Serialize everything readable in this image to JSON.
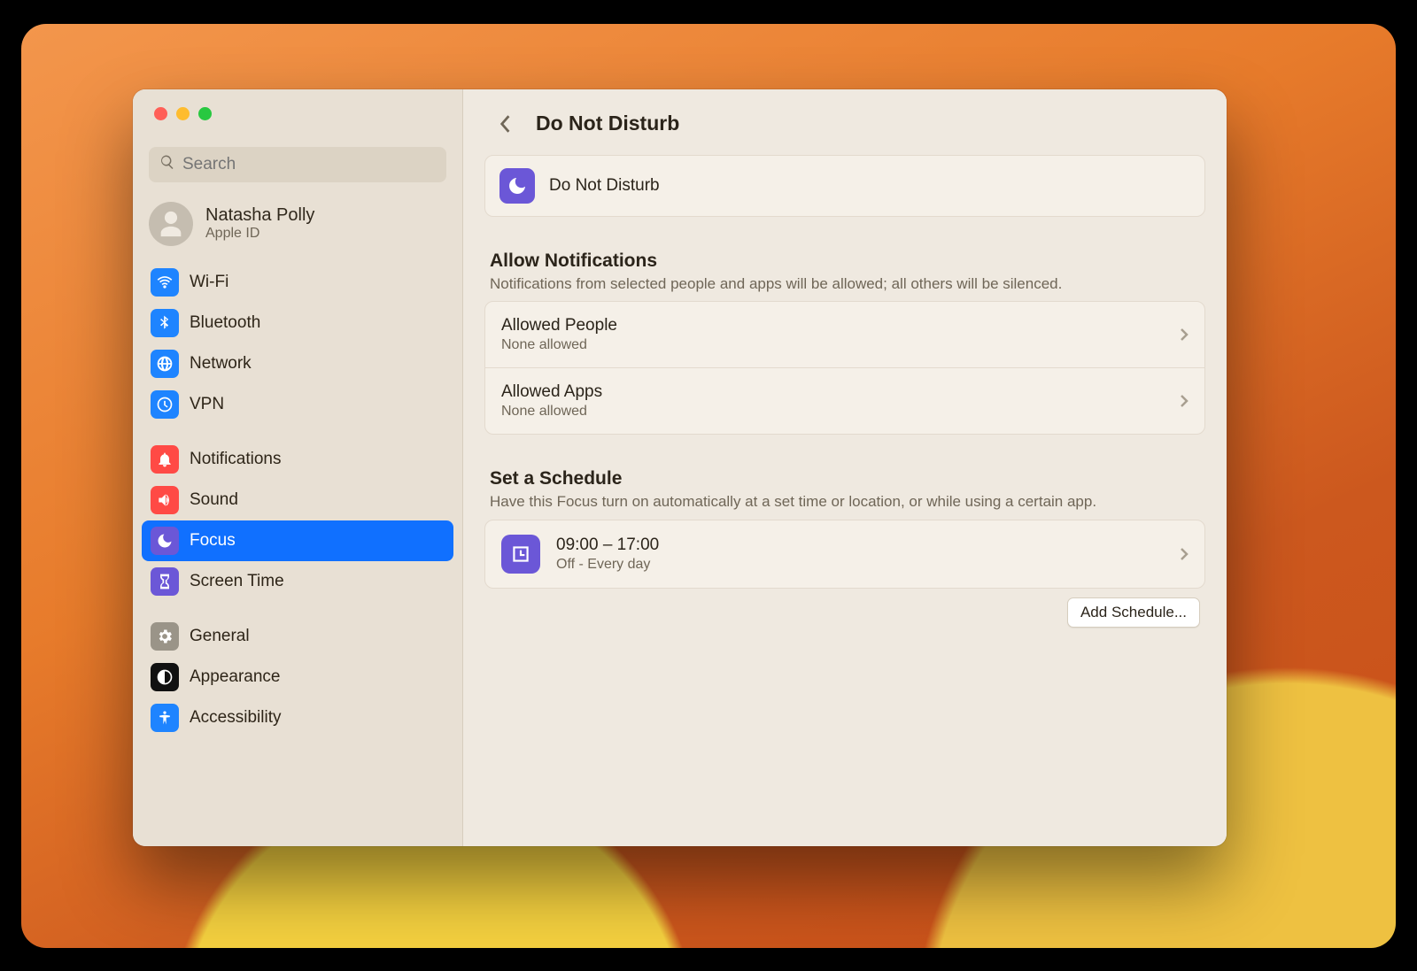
{
  "window": {
    "title": "Do Not Disturb"
  },
  "search": {
    "placeholder": "Search"
  },
  "account": {
    "name": "Natasha Polly",
    "sub": "Apple ID"
  },
  "sidebar": {
    "groups": [
      [
        {
          "id": "wifi",
          "label": "Wi-Fi",
          "color": "#1e84ff"
        },
        {
          "id": "bluetooth",
          "label": "Bluetooth",
          "color": "#1e84ff"
        },
        {
          "id": "network",
          "label": "Network",
          "color": "#1e84ff"
        },
        {
          "id": "vpn",
          "label": "VPN",
          "color": "#1e84ff"
        }
      ],
      [
        {
          "id": "notifications",
          "label": "Notifications",
          "color": "#ff4a45"
        },
        {
          "id": "sound",
          "label": "Sound",
          "color": "#ff4a45"
        },
        {
          "id": "focus",
          "label": "Focus",
          "color": "#6b57d7",
          "selected": true
        },
        {
          "id": "screentime",
          "label": "Screen Time",
          "color": "#6b57d7"
        }
      ],
      [
        {
          "id": "general",
          "label": "General",
          "color": "#9a9488"
        },
        {
          "id": "appearance",
          "label": "Appearance",
          "color": "#111111"
        },
        {
          "id": "accessibility",
          "label": "Accessibility",
          "color": "#1e84ff"
        }
      ]
    ]
  },
  "dnd": {
    "title": "Do Not Disturb"
  },
  "allow": {
    "heading": "Allow Notifications",
    "desc": "Notifications from selected people and apps will be allowed; all others will be silenced.",
    "people": {
      "title": "Allowed People",
      "sub": "None allowed"
    },
    "apps": {
      "title": "Allowed Apps",
      "sub": "None allowed"
    }
  },
  "schedule": {
    "heading": "Set a Schedule",
    "desc": "Have this Focus turn on automatically at a set time or location, or while using a certain app.",
    "row": {
      "title": "09:00 – 17:00",
      "sub": "Off - Every day"
    },
    "add_button": "Add Schedule..."
  }
}
